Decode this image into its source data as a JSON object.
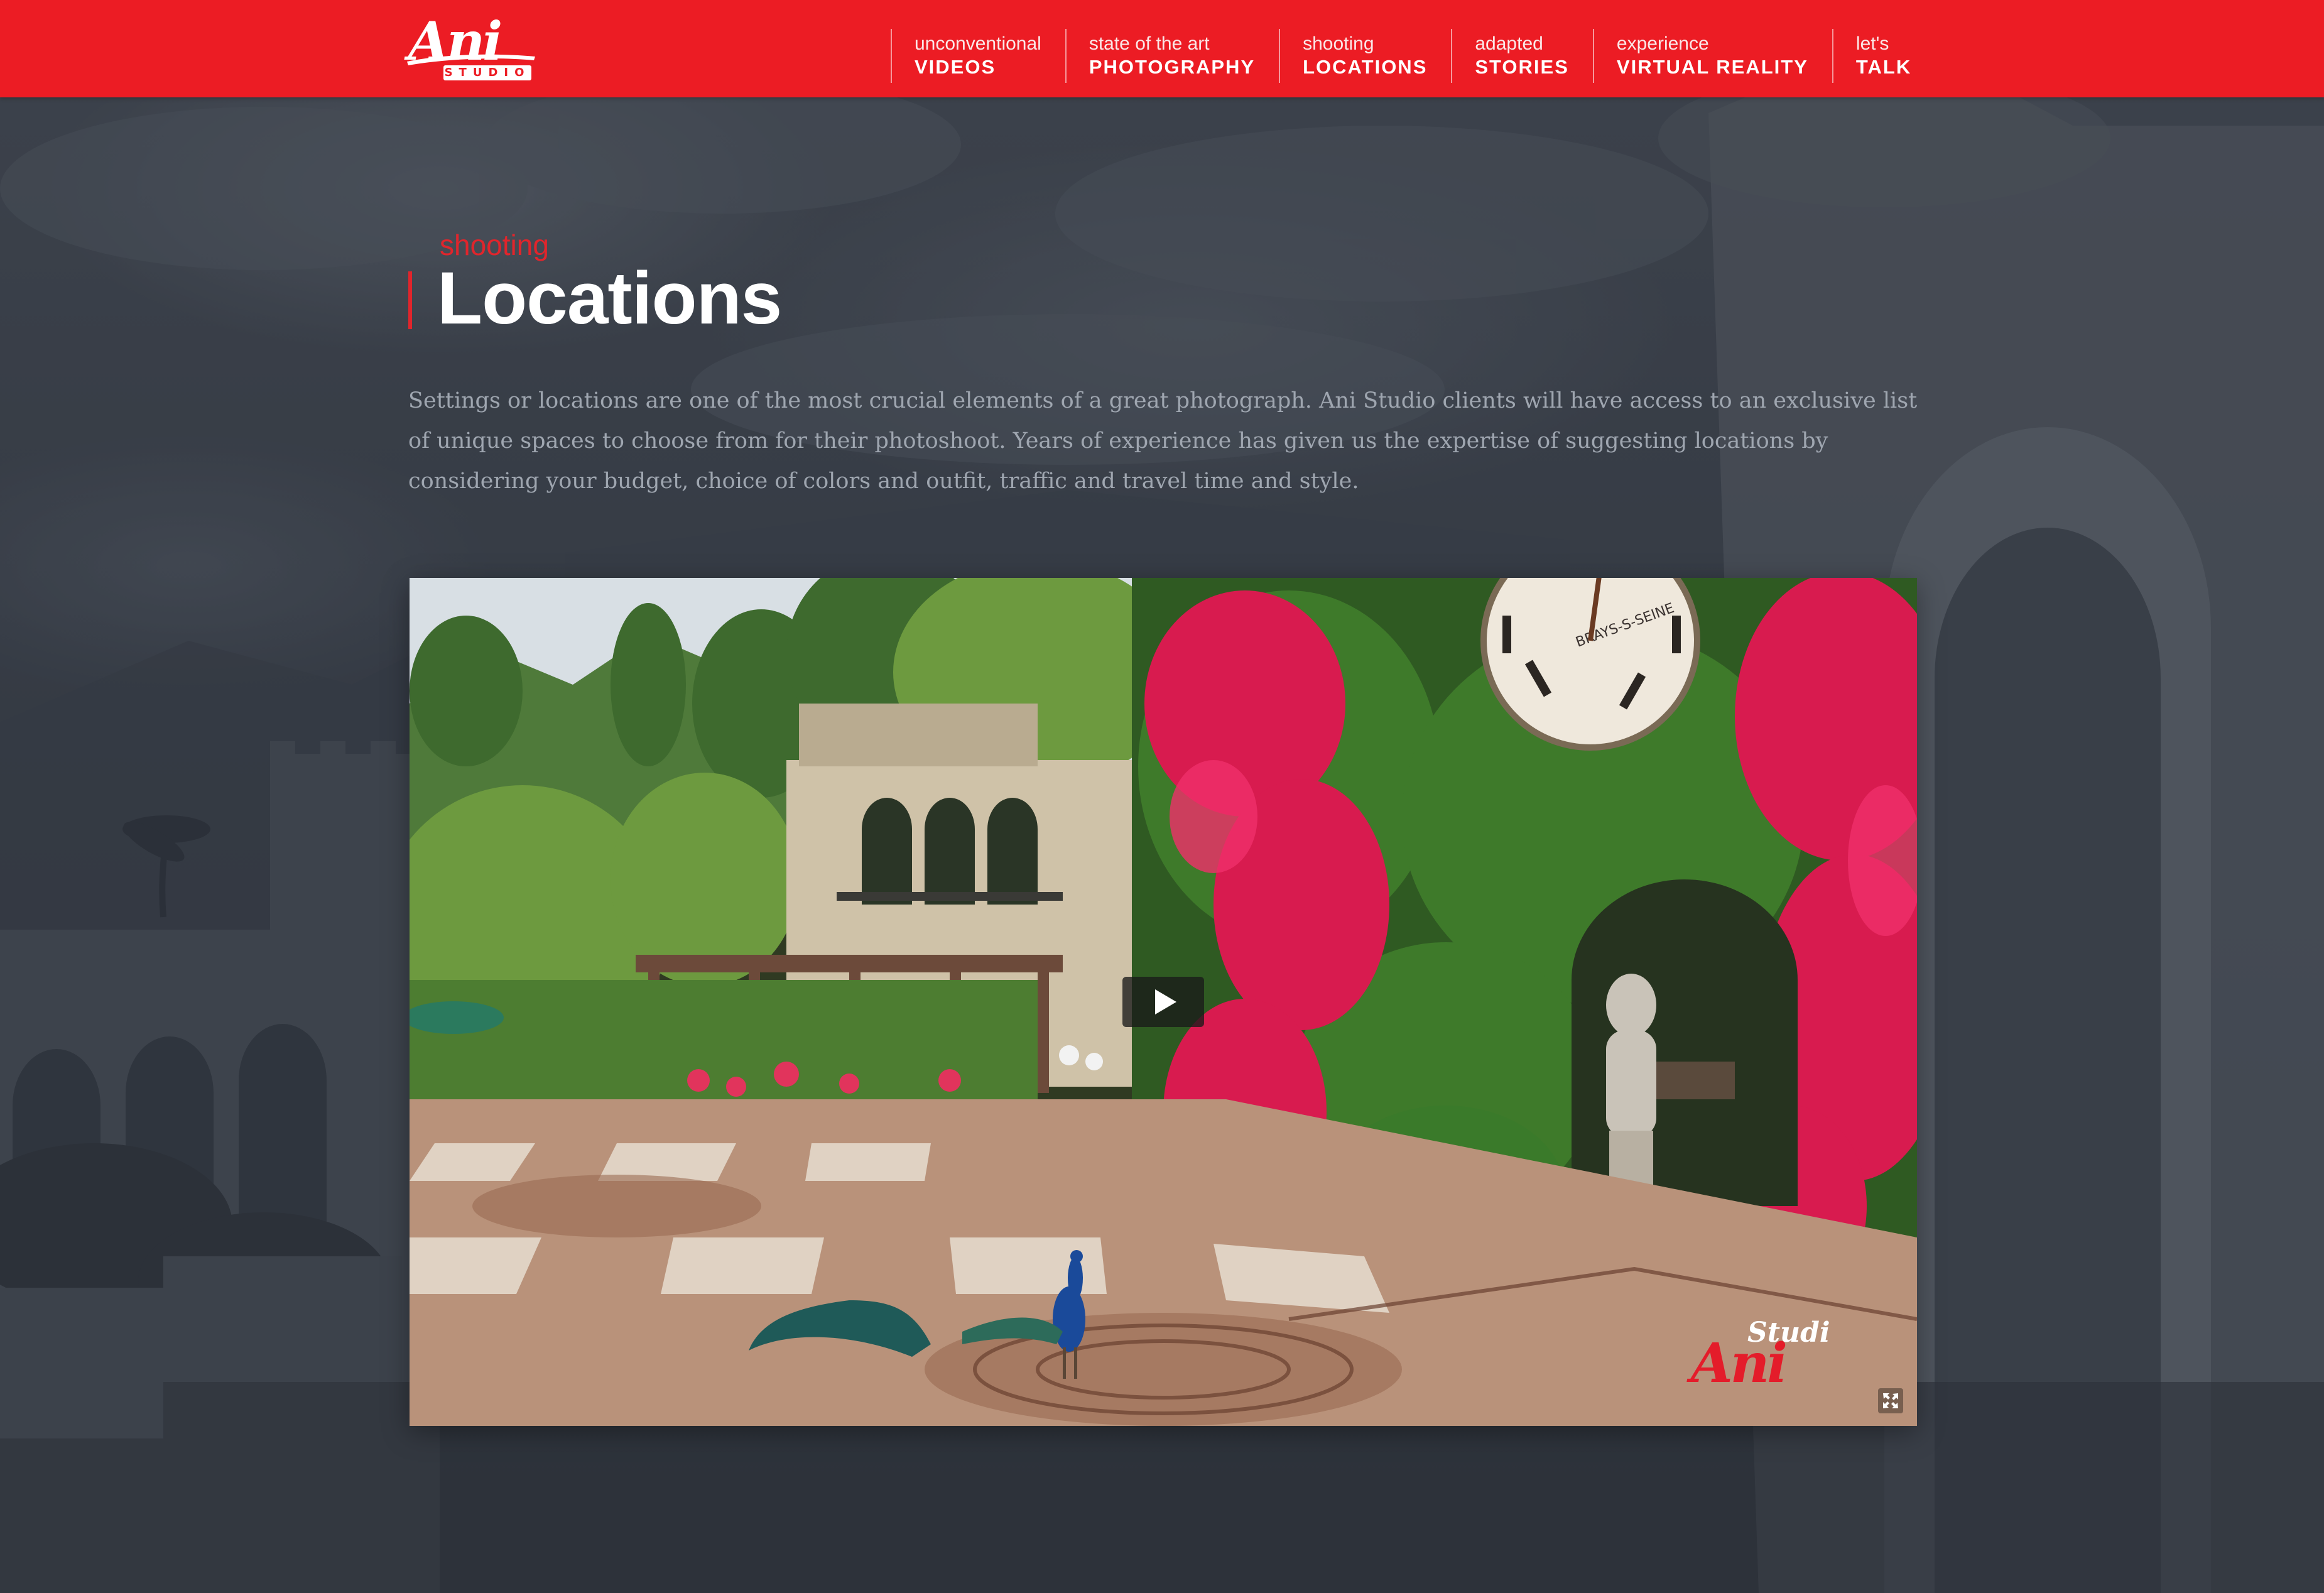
{
  "brand": {
    "logo_word": "Ani",
    "logo_sub": "STUDIO",
    "accent_color": "#ec1c24"
  },
  "nav": {
    "items": [
      {
        "small": "unconventional",
        "big": "VIDEOS"
      },
      {
        "small": "state of the art",
        "big": "PHOTOGRAPHY"
      },
      {
        "small": "shooting",
        "big": "LOCATIONS"
      },
      {
        "small": "adapted",
        "big": "STORIES"
      },
      {
        "small": "experience",
        "big": "VIRTUAL REALITY"
      },
      {
        "small": "let's",
        "big": "TALK"
      }
    ]
  },
  "section": {
    "eyebrow": "shooting",
    "title": "Locations",
    "description": "Settings or locations are one of the most crucial elements of a great photograph.  Ani Studio clients will have access to an exclusive list of unique spaces to choose from for their photoshoot. Years of experience has given us the expertise of suggesting locations by considering your budget, choice of colors and outfit, traffic and travel time and style."
  },
  "video": {
    "play_icon": "play-icon",
    "fullscreen_icon": "fullscreen-icon",
    "watermark_top": "Studi",
    "watermark_main": "Ani",
    "clock_text": "BRAYS-S-SEINE"
  }
}
